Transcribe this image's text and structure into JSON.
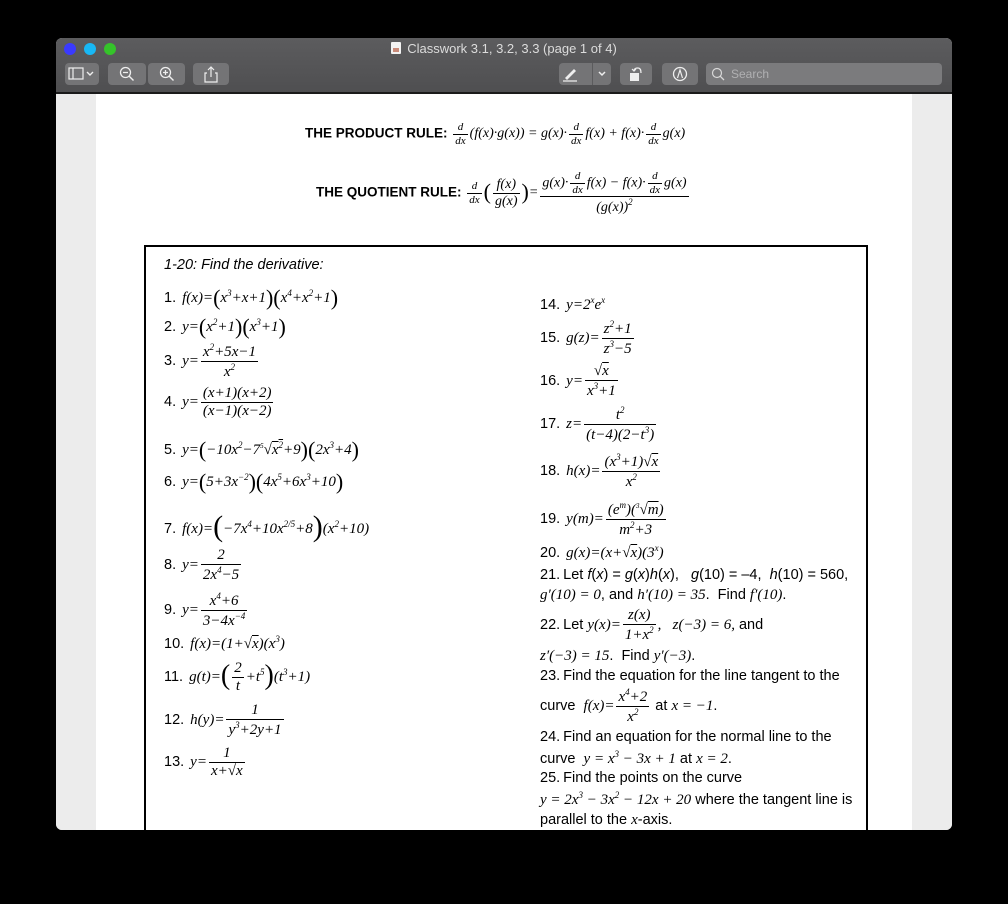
{
  "window": {
    "title": "Classwork 3.1, 3.2, 3.3 (page 1 of 4)",
    "toolbar": {
      "sidebar_toggle": "sidebar-toggle",
      "zoom_out": "zoom-out",
      "zoom_in": "zoom-in",
      "share": "share",
      "markup_pen": "markup-pen",
      "rotate": "rotate",
      "annotate": "annotate",
      "search_placeholder": "Search",
      "search_value": ""
    }
  },
  "rules": {
    "product_label": "THE PRODUCT RULE:",
    "product_formula": "d/dx(f(x)·g(x)) = g(x)·d/dx f(x) + f(x)·d/dx g(x)",
    "quotient_label": "THE QUOTIENT RULE:",
    "quotient_formula": "d/dx(f(x)/g(x)) = (g(x)·d/dx f(x) − f(x)·d/dx g(x)) / (g(x))²"
  },
  "worksheet": {
    "heading": "1-20: Find the derivative:",
    "problems": [
      {
        "n": "1.",
        "text": "f(x) = (x³ + x + 1)(x⁴ + x² + 1)"
      },
      {
        "n": "2.",
        "text": "y = (x² + 1)(x³ + 1)"
      },
      {
        "n": "3.",
        "text": "y = (x² + 5x − 1) / x²"
      },
      {
        "n": "4.",
        "text": "y = (x+1)(x+2) / (x−1)(x−2)"
      },
      {
        "n": "5.",
        "text": "y = (−10x² − 7∜x² + 9)(2x³ + 4)"
      },
      {
        "n": "6.",
        "text": "y = (5 + 3x⁻²)(4x⁵ + 6x³ + 10)"
      },
      {
        "n": "7.",
        "text": "f(x) = (−7x⁴ + 10x^(2/5) + 8)(x² + 10)"
      },
      {
        "n": "8.",
        "text": "y = 2 / (2x⁴ − 5)"
      },
      {
        "n": "9.",
        "text": "y = (x⁴ + 6) / (3 − 4x⁻⁴)"
      },
      {
        "n": "10.",
        "text": "f(x) = (1 + √x)(x³)"
      },
      {
        "n": "11.",
        "text": "g(t) = (2/t + t⁵)(t³ + 1)"
      },
      {
        "n": "12.",
        "text": "h(y) = 1 / (y³ + 2y + 1)"
      },
      {
        "n": "13.",
        "text": "y = 1 / (x + √x)"
      },
      {
        "n": "14.",
        "text": "y = 2ˣ eˣ"
      },
      {
        "n": "15.",
        "text": "g(z) = (z² + 1) / (z³ − 5)"
      },
      {
        "n": "16.",
        "text": "y = √x / (x³ + 1)"
      },
      {
        "n": "17.",
        "text": "z = t² / (t − 4)(2 − t³)"
      },
      {
        "n": "18.",
        "text": "h(x) = (x³ + 1)√x / x²"
      },
      {
        "n": "19.",
        "text": "y(m) = (eᵐ)(∛m) / (m² + 3)"
      },
      {
        "n": "20.",
        "text": "g(x) = (x + √x)(3ˣ)"
      },
      {
        "n": "21.",
        "text": "Let f(x) = g(x)h(x),  g(10) = −4,  h(10) = 560, g′(10) = 0, and h′(10) = 35.  Find f′(10)."
      },
      {
        "n": "22.",
        "text": "Let y(x) = z(x)/(1 + x²),  z(−3) = 6, and z′(−3) = 15.  Find y′(−3)."
      },
      {
        "n": "23.",
        "text": "Find the equation for the line tangent to the curve f(x) = (x⁴ + 2)/x² at x = −1."
      },
      {
        "n": "24.",
        "text": "Find an equation for the normal line to the curve y = x³ − 3x + 1 at x = 2."
      },
      {
        "n": "25.",
        "text": "Find the points on the curve y = 2x³ − 3x² − 12x + 20 where the tangent line is parallel to the x-axis."
      }
    ]
  }
}
